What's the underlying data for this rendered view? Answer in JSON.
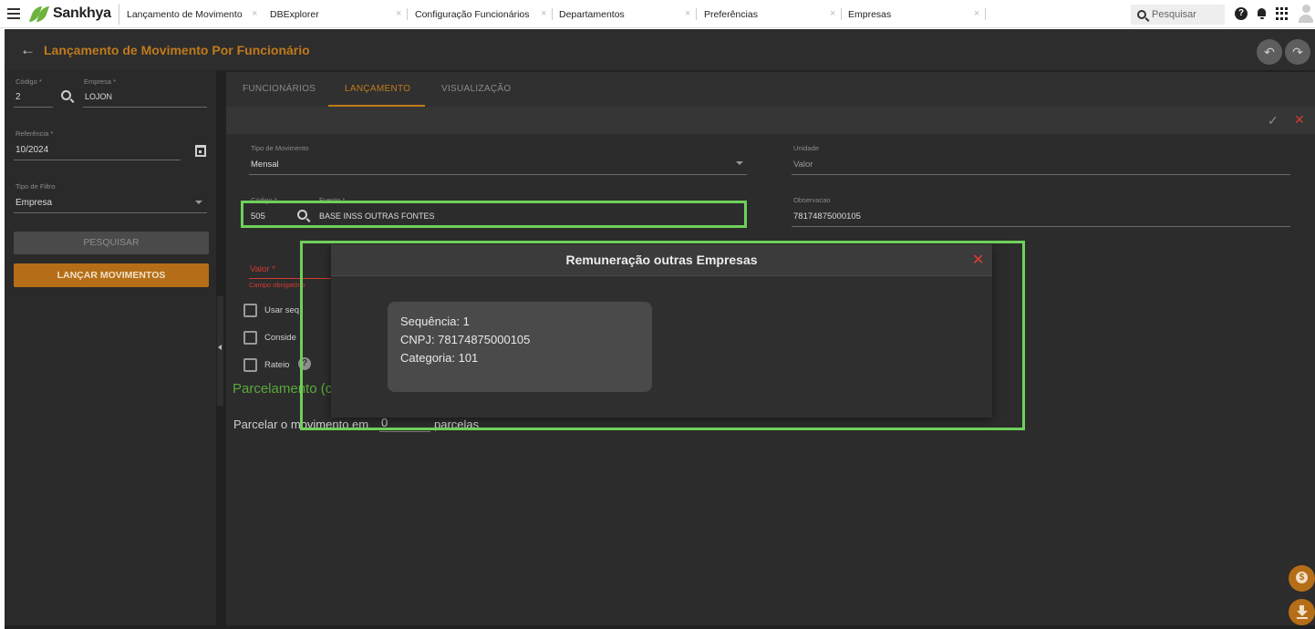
{
  "app": {
    "brand": "Sankhya"
  },
  "tabs": [
    {
      "label": "Lançamento de Movimento"
    },
    {
      "label": "DBExplorer"
    },
    {
      "label": "Configuração Funcionários"
    },
    {
      "label": "Departamentos"
    },
    {
      "label": "Preferências"
    },
    {
      "label": "Empresas"
    }
  ],
  "tab_close_glyph": "×",
  "search": {
    "placeholder": "Pesquisar"
  },
  "help_glyph": "?",
  "page": {
    "back_glyph": "←",
    "title": "Lançamento de Movimento Por Funcionário",
    "undo_glyph": "↶",
    "redo_glyph": "↷"
  },
  "left": {
    "codigo": {
      "label": "Código *",
      "value": "2"
    },
    "empresa": {
      "label": "Empresa *",
      "value": "LOJON"
    },
    "referencia": {
      "label": "Referência *",
      "value": "10/2024"
    },
    "tipo_filtro": {
      "label": "Tipo de Filtro",
      "value": "Empresa"
    },
    "btn_pesquisar": "PESQUISAR",
    "btn_lancar": "LANÇAR MOVIMENTOS"
  },
  "main_tabs": [
    {
      "label": "FUNCIONÁRIOS"
    },
    {
      "label": "LANÇAMENTO"
    },
    {
      "label": "VISUALIZAÇÃO"
    }
  ],
  "actions": {
    "confirm_glyph": "✓",
    "cancel_glyph": "✕"
  },
  "form": {
    "tipo_movimento": {
      "label": "Tipo de Movimento",
      "value": "Mensal"
    },
    "unidade": {
      "label": "Unidade",
      "value": "Valor"
    },
    "codigo": {
      "label": "Código *",
      "value": "505"
    },
    "evento": {
      "label": "Evento *",
      "value": "BASE INSS OUTRAS FONTES"
    },
    "observacao": {
      "label": "Observacao",
      "value": "78174875000105"
    },
    "valor": {
      "label": "Valor *",
      "error": "Campo obrigatório"
    },
    "checkboxes": [
      {
        "label": "Usar seq"
      },
      {
        "label": "Conside"
      },
      {
        "label": "Rateio"
      }
    ],
    "parcelamento_title": "Parcelamento (c",
    "parcelar_prefix": "Parcelar o movimento em",
    "parcelar_value": "0",
    "parcelar_suffix": "parcelas"
  },
  "modal": {
    "title": "Remuneração outras Empresas",
    "close_glyph": "✕",
    "tooltip": {
      "sequencia": "Sequência: 1",
      "cnpj": "CNPJ: 78174875000105",
      "categoria": "Categoria: 101"
    }
  },
  "colors": {
    "accent": "#c07a1c",
    "success": "#5aa83c",
    "error": "#d23a30",
    "highlight": "#6fd05a"
  }
}
